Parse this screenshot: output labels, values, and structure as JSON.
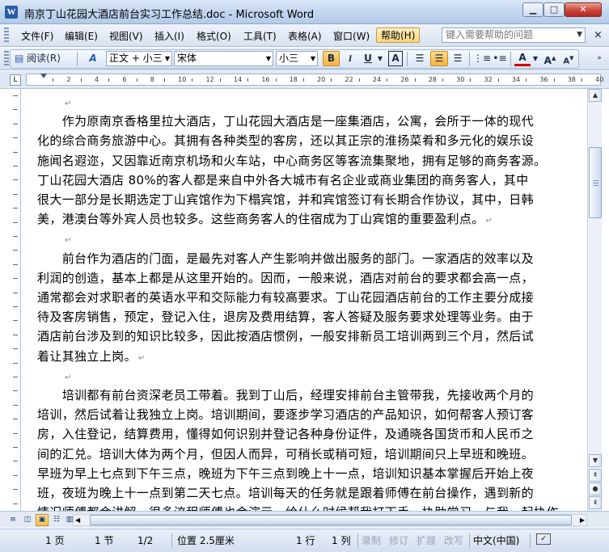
{
  "window": {
    "title": "南京丁山花园大酒店前台实习工作总结.doc - Microsoft Word",
    "app_icon": "W",
    "minimize": "▁",
    "maximize": "□",
    "close": "✕"
  },
  "menu": {
    "items": [
      "文件(F)",
      "编辑(E)",
      "视图(V)",
      "插入(I)",
      "格式(O)",
      "工具(T)",
      "表格(A)",
      "窗口(W)",
      "帮助(H)"
    ],
    "active_index": 8,
    "help_placeholder": "键入需要帮助的问题",
    "close_doc": "×"
  },
  "toolbar": {
    "reading_label": "阅读(R)",
    "style_icon": "A",
    "style_value": "正文 + 小三",
    "font_value": "宋体",
    "size_value": "小三",
    "bold": "B",
    "italic": "I",
    "underline": "U",
    "char_border": "A",
    "font_color": "A",
    "grow_font": "A",
    "shrink_font": "A"
  },
  "ruler": {
    "labels": [
      "2",
      "4",
      "6",
      "8",
      "10",
      "12",
      "14",
      "16",
      "18",
      "20",
      "22",
      "24",
      "26",
      "28",
      "30",
      "32",
      "34",
      "36",
      "38",
      "40"
    ]
  },
  "document": {
    "lines": [
      {
        "text": "",
        "mark": true
      },
      {
        "text": "　　作为原南京香格里拉大酒店，丁山花园大酒店是一座集酒店，公寓，会所于一体的现代",
        "mark": false
      },
      {
        "text": "化的综合商务旅游中心。其拥有各种类型的客房，还以其正宗的淮扬菜肴和多元化的娱乐设",
        "mark": false
      },
      {
        "text": "施闻名遐迩，又因靠近南京机场和火车站，中心商务区等客流集聚地，拥有足够的商务客源。",
        "mark": false
      },
      {
        "text": "丁山花园大酒店 80%的客人都是来自中外各大城市有名企业或商业集团的商务客人，其中",
        "mark": false
      },
      {
        "text": "很大一部分是长期选定丁山宾馆作为下榻宾馆，并和宾馆签订有长期合作协议，其中，日韩",
        "mark": false
      },
      {
        "text": "美，港澳台等外宾人员也较多。这些商务客人的住宿成为丁山宾馆的重要盈利点。",
        "mark": true
      },
      {
        "text": "",
        "mark": true
      },
      {
        "text": "　　前台作为酒店的门面，是最先对客人产生影响并做出服务的部门。一家酒店的效率以及",
        "mark": false
      },
      {
        "text": "利润的创造，基本上都是从这里开始的。因而，一般来说，酒店对前台的要求都会高一点，",
        "mark": false
      },
      {
        "text": "通常都会对求职者的英语水平和交际能力有较高要求。丁山花园酒店前台的工作主要分成接",
        "mark": false
      },
      {
        "text": "待及客房销售，预定，登记入住，退房及费用结算，客人答疑及服务要求处理等业务。由于",
        "mark": false
      },
      {
        "text": "酒店前台涉及到的知识比较多，因此按酒店惯例，一般安排新员工培训两到三个月，然后试",
        "mark": false
      },
      {
        "text": "着让其独立上岗。",
        "mark": true
      },
      {
        "text": "",
        "mark": true
      },
      {
        "text": "　　培训都有前台资深老员工带着。我到丁山后，经理安排前台主管带我，先接收两个月的",
        "mark": false
      },
      {
        "text": "培训，然后试着让我独立上岗。培训期间，要逐步学习酒店的产品知识，如何帮客人预订客",
        "mark": false
      },
      {
        "text": "房，入住登记，结算费用，懂得如何识别并登记各种身份证件，及通晓各国货币和人民币之",
        "mark": false
      },
      {
        "text": "间的汇兑。培训大体为两个月，但因人而异，可稍长或稍可短，培训期间只上早班和晚班。",
        "mark": false
      },
      {
        "text": "早班为早上七点到下午三点，晚班为下午三点到晚上十一点，培训知识基本掌握后开始上夜",
        "mark": false
      },
      {
        "text": "班，夜班为晚上十一点到第二天七点。培训每天的任务就是跟着师傅在前台操作，遇到新的",
        "mark": false
      },
      {
        "text": "情况师傅都会讲解，很多流程师傅也会演示，给什么时候帮我打下手，协助学习，与我一起协作",
        "mark": false
      }
    ],
    "paragraph_mark": "↵"
  },
  "scrollbar": {
    "up": "▲",
    "down": "▼",
    "prev_page": "⇞",
    "browse": "●",
    "next_page": "⇟"
  },
  "statusbar": {
    "page": "1 页",
    "section": "1 节",
    "page_of": "1/2",
    "position": "位置 2.5厘米",
    "line": "1 行",
    "column": "1 列",
    "rec": "录制",
    "trk": "修订",
    "ext": "扩展",
    "ovr": "改写",
    "language": "中文(中国)"
  }
}
